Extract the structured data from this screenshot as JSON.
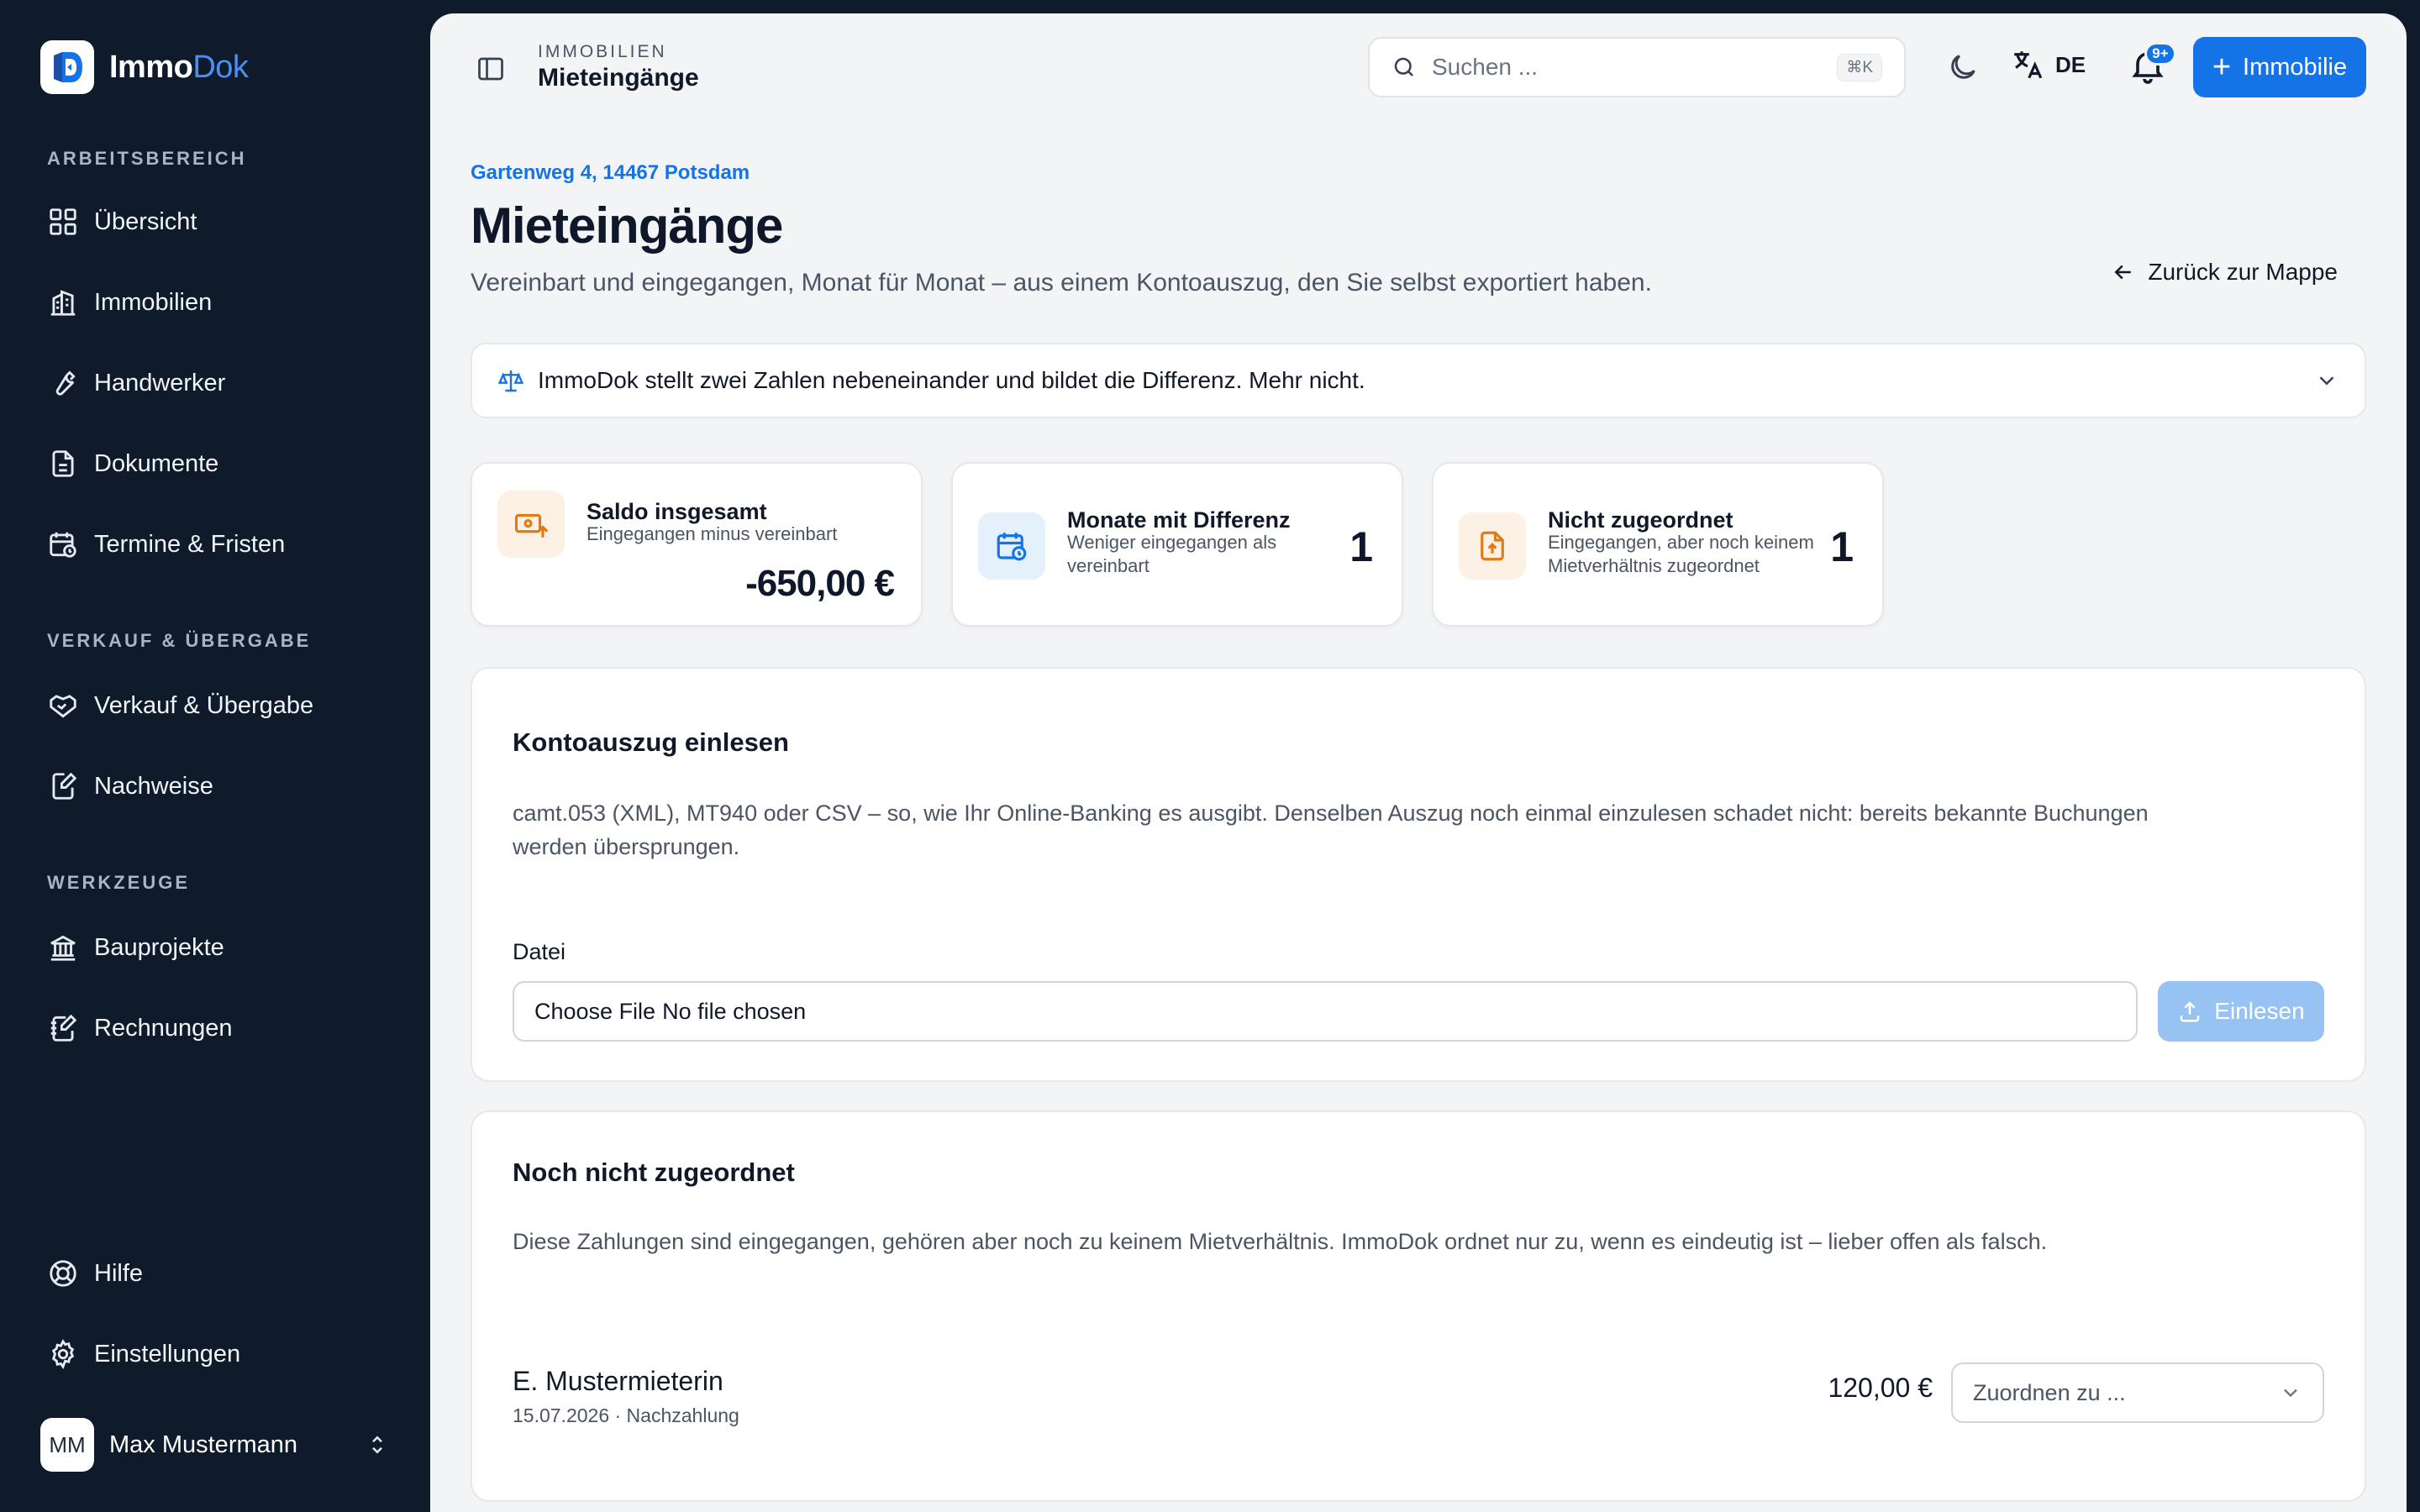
{
  "brand": {
    "name_part1": "Immo",
    "name_part2": "Dok"
  },
  "sidebar": {
    "sections": {
      "workspace": "ARBEITSBEREICH",
      "sale": "VERKAUF & ÜBERGABE",
      "tools": "WERKZEUGE"
    },
    "items": {
      "overview": "Übersicht",
      "properties": "Immobilien",
      "craftsmen": "Handwerker",
      "documents": "Dokumente",
      "appointments": "Termine & Fristen",
      "sale": "Verkauf & Übergabe",
      "proofs": "Nachweise",
      "construction": "Bauprojekte",
      "invoices": "Rechnungen",
      "help": "Hilfe",
      "settings": "Einstellungen"
    },
    "user": {
      "initials": "MM",
      "name": "Max Mustermann"
    }
  },
  "header": {
    "breadcrumb_parent": "IMMOBILIEN",
    "breadcrumb_current": "Mieteingänge",
    "search_placeholder": "Suchen ...",
    "search_shortcut": "⌘K",
    "language": "DE",
    "notification_count": "9+",
    "new_property_label": "Immobilie"
  },
  "page": {
    "address": "Gartenweg 4, 14467 Potsdam",
    "title": "Mieteingänge",
    "subtitle": "Vereinbart und eingegangen, Monat für Monat – aus einem Kontoauszug, den Sie selbst exportiert haben.",
    "back_label": "Zurück zur Mappe",
    "info_text": "ImmoDok stellt zwei Zahlen nebeneinander und bildet die Differenz. Mehr nicht."
  },
  "stats": [
    {
      "title": "Saldo insgesamt",
      "subtitle": "Eingegangen minus vereinbart",
      "value": "-650,00 €",
      "icon": "money-upload-icon",
      "color": "#f08a24"
    },
    {
      "title": "Monate mit Differenz",
      "subtitle_line1": "Weniger eingegangen als",
      "subtitle_line2": "vereinbart",
      "value": "1",
      "icon": "calendar-clock-icon",
      "color": "#1473e6"
    },
    {
      "title": "Nicht zugeordnet",
      "subtitle_line1": "Eingegangen, aber noch keinem",
      "subtitle_line2": "Mietverhältnis zugeordnet",
      "value": "1",
      "icon": "file-upload-icon",
      "color": "#f08a24"
    }
  ],
  "import_panel": {
    "title": "Kontoauszug einlesen",
    "description": "camt.053 (XML), MT940 oder CSV – so, wie Ihr Online-Banking es ausgibt. Denselben Auszug noch einmal einzulesen schadet nicht: bereits bekannte Buchungen werden übersprungen.",
    "file_label": "Datei",
    "choose_file": "Choose File",
    "no_file": "No file chosen",
    "submit_label": "Einlesen"
  },
  "unassigned_panel": {
    "title": "Noch nicht zugeordnet",
    "description": "Diese Zahlungen sind eingegangen, gehören aber noch zu keinem Mietverhältnis. ImmoDok ordnet nur zu, wenn es eindeutig ist – lieber offen als falsch.",
    "payments": [
      {
        "name": "E. Mustermieterin",
        "meta": "15.07.2026 · Nachzahlung",
        "amount": "120,00 €",
        "assign_placeholder": "Zuordnen zu ..."
      }
    ]
  }
}
